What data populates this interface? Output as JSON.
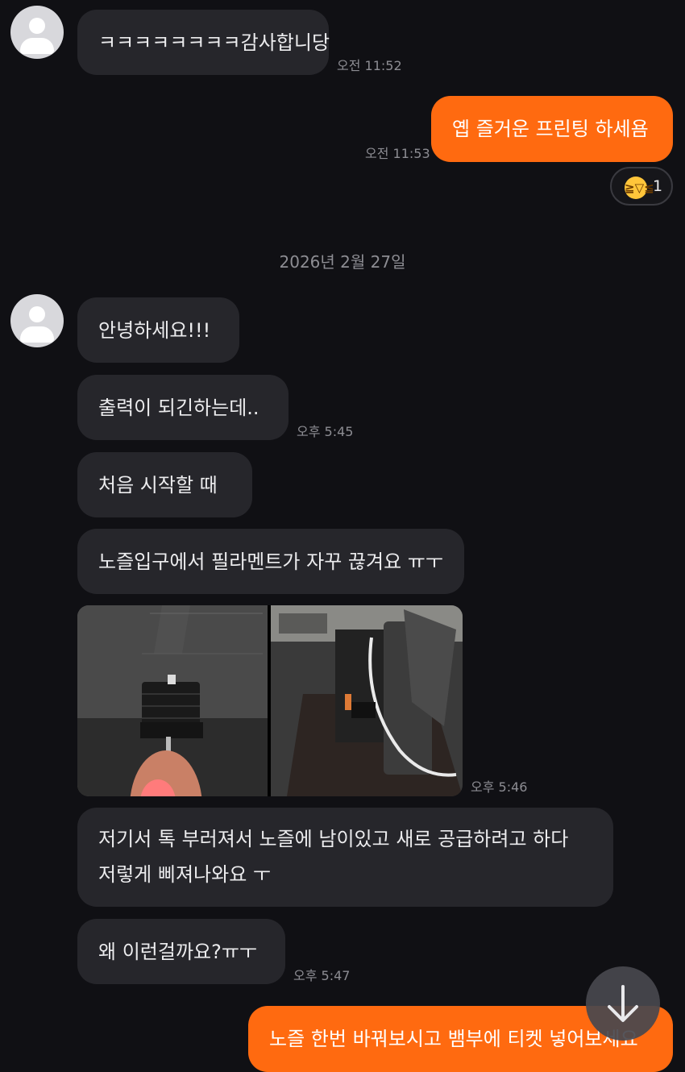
{
  "messages": {
    "m1": {
      "text": "ㅋㅋㅋㅋㅋㅋㅋㅋ감사합니당",
      "time": "오전 11:52"
    },
    "m2": {
      "text": "옙 즐거운 프린팅 하세욤",
      "time": "오전 11:53"
    },
    "reaction": {
      "emoji": "laughing-face-emoji",
      "count": "1"
    },
    "date_separator": "2026년 2월 27일",
    "m3": {
      "text": "안녕하세요!!!"
    },
    "m4": {
      "text": "출력이 되긴하는데..",
      "time": "오후 5:45"
    },
    "m5": {
      "text": "처음 시작할 때"
    },
    "m6": {
      "text": "노즐입구에서 필라멘트가 자꾸 끊겨요 ㅠㅜ"
    },
    "photos": {
      "time": "오후 5:46"
    },
    "m7": {
      "line1": "저기서 톡 부러져서 노즐에 남이있고 새로 공급하려고 하다",
      "line2": "저렇게 삐져나와요 ㅜ"
    },
    "m8": {
      "text": "왜 이런걸까요?ㅠㅜ",
      "time": "오후 5:47"
    },
    "m9": {
      "text": "노즐 한번 바꿔보시고 뱀부에 티켓 넣어보세요"
    }
  },
  "colors": {
    "background": "#101014",
    "incoming_bubble": "#26262b",
    "outgoing_bubble": "#ff6a10",
    "timestamp": "#8d8d93"
  }
}
